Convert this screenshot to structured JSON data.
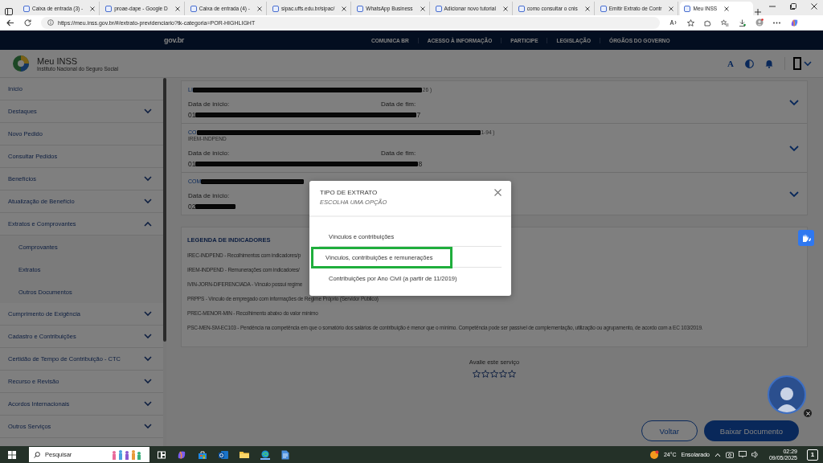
{
  "browser": {
    "tabs": [
      {
        "title": "Caixa de entrada (3) -",
        "selected": false
      },
      {
        "title": "proae-dape - Google D",
        "selected": false
      },
      {
        "title": "Caixa de entrada (4) -",
        "selected": false
      },
      {
        "title": "sipac.uffs.edu.br/sipac/",
        "selected": false
      },
      {
        "title": "WhatsApp Business",
        "selected": false
      },
      {
        "title": "Adicionar novo tutorial",
        "selected": false
      },
      {
        "title": "como consultar o cnis",
        "selected": false
      },
      {
        "title": "Emitir Extrato de Contr",
        "selected": false
      },
      {
        "title": "Meu INSS",
        "selected": true
      }
    ],
    "address": "https://meu.inss.gov.br/#/extrato-previdenciario?tk-categoria=POR-HIGHLIGHT"
  },
  "gov_bar": {
    "logo": "gov.br",
    "links": [
      "COMUNICA BR",
      "ACESSO À INFORMAÇÃO",
      "PARTICIPE",
      "LEGISLAÇÃO",
      "ÓRGÃOS DO GOVERNO"
    ]
  },
  "header": {
    "title": "Meu INSS",
    "subtitle": "Instituto Nacional do Seguro Social",
    "font_button": "A"
  },
  "sidebar": {
    "items": [
      {
        "label": "Início",
        "kind": "link"
      },
      {
        "label": "Destaques",
        "kind": "group",
        "expanded": false
      },
      {
        "label": "Novo Pedido",
        "kind": "link"
      },
      {
        "label": "Consultar Pedidos",
        "kind": "link"
      },
      {
        "label": "Benefícios",
        "kind": "group",
        "expanded": false
      },
      {
        "label": "Atualização de Benefício",
        "kind": "group",
        "expanded": false
      },
      {
        "label": "Extratos e Comprovantes",
        "kind": "group",
        "expanded": true,
        "children": [
          {
            "label": "Comprovantes"
          },
          {
            "label": "Extratos"
          },
          {
            "label": "Outros Documentos"
          }
        ]
      },
      {
        "label": "Cumprimento de Exigência",
        "kind": "group",
        "expanded": false
      },
      {
        "label": "Cadastro e Contribuições",
        "kind": "group",
        "expanded": false
      },
      {
        "label": "Certidão de Tempo de Contribuição - CTC",
        "kind": "group",
        "expanded": false
      },
      {
        "label": "Recurso e Revisão",
        "kind": "group",
        "expanded": false
      },
      {
        "label": "Acordos Internacionais",
        "kind": "group",
        "expanded": false
      },
      {
        "label": "Outros Serviços",
        "kind": "group",
        "expanded": false
      }
    ]
  },
  "records": [
    {
      "title_start": "LI",
      "title_end": "26 )",
      "fields": [
        "Data de início:",
        "Data de fim:"
      ],
      "value_start": "01",
      "value_end": "7"
    },
    {
      "title_start": "CO",
      "title_end": "1-94 )",
      "tag": "IREM-INDPEND",
      "fields": [
        "Data de início:",
        "Data de fim:"
      ],
      "value_start": "01",
      "value_end": "8"
    },
    {
      "title_start": "COM",
      "fields": [
        "Data de início:"
      ],
      "value_start": "02"
    }
  ],
  "legend": {
    "title": "LEGENDA DE INDICADORES",
    "lines": [
      "IREC-INDPEND - Recolhimentos com indicadores/p",
      "IREM-INDPEND - Remunerações com indicadores/",
      "IVIN-JORN-DIFERENCIADA - Vínculo possui regime",
      "PRPPS - Vínculo de empregado com informações de Regime Próprio (Servidor Público)",
      "PREC-MENOR-MIN - Recolhimento abaixo do valor mínimo",
      "PSC-MEN-SM-EC103 - Pendência na competência em que o somatório dos salários de contribuição é menor que o mínimo. Competência pode ser passível de complementação, utilização ou agrupamento, de acordo com a EC 103/2019."
    ]
  },
  "rating": {
    "label": "Avalie este serviço",
    "stars": 0
  },
  "actions": [
    {
      "label": "Voltar",
      "kind": "secondary"
    },
    {
      "label": "Baixar Documento",
      "kind": "primary"
    }
  ],
  "modal": {
    "title": "TIPO DE EXTRATO",
    "subtitle": "ESCOLHA UMA OPÇÃO",
    "options": [
      {
        "label": "Vínculos e contribuições",
        "selected": false
      },
      {
        "label": "Vínculos, contribuições e remunerações",
        "selected": true
      },
      {
        "label": "Contribuições por Ano Civil (a partir de 11/2019)",
        "selected": false
      }
    ]
  },
  "taskbar": {
    "search_placeholder": "Pesquisar",
    "temperature": "24°C",
    "weather": "Ensolarado",
    "time": "02:29",
    "date": "09/05/2025",
    "notifications": "1"
  }
}
